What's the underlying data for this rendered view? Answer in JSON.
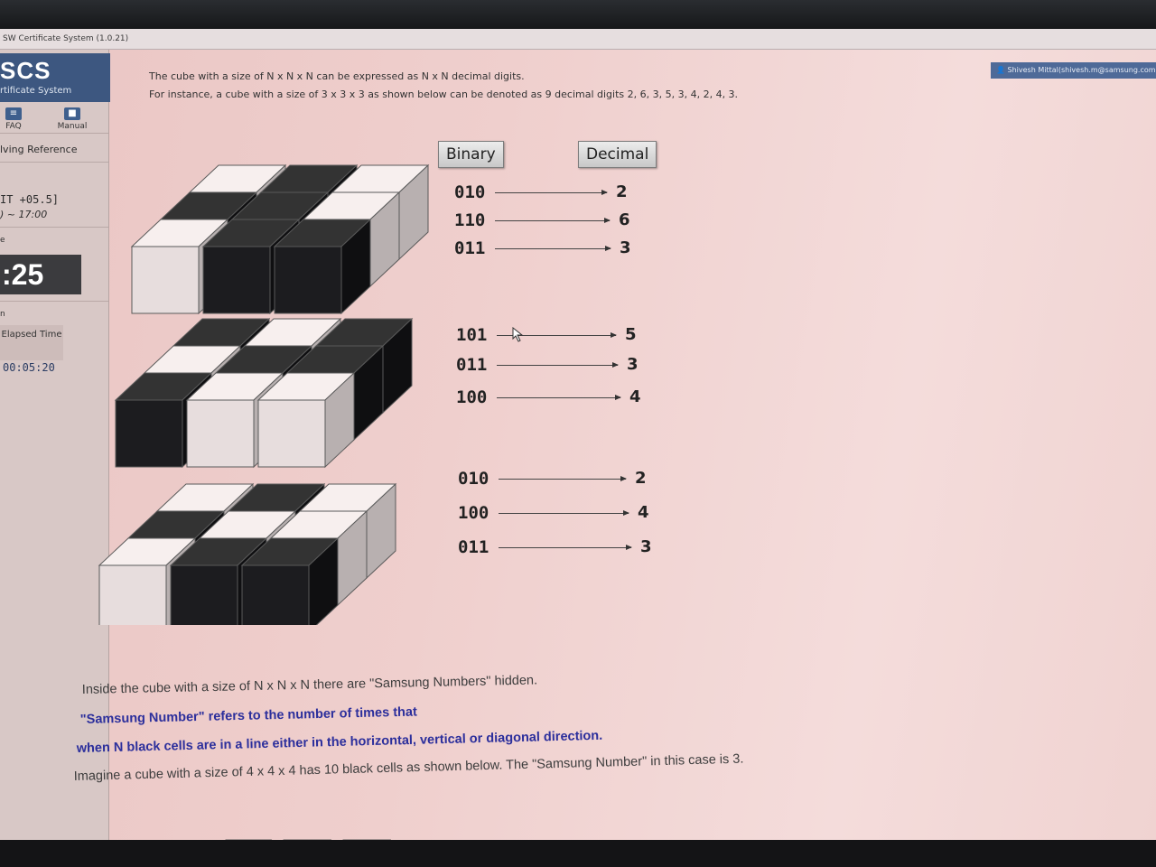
{
  "window": {
    "title": "SW Certificate System (1.0.21)"
  },
  "sidebar": {
    "logo": "SCS",
    "logo_sub": "rtificate System",
    "faq_label": "FAQ",
    "manual_label": "Manual",
    "reference_label": "lving Reference",
    "timezone": "IT +05.5]",
    "hours": ") ~ 17:00",
    "small_mark": "e",
    "timer": ":25",
    "small_mark2": "n",
    "elapsed_label": "Elapsed Time",
    "elapsed_value": "00:05:20"
  },
  "header": {
    "user": "Shivesh Mittal(shivesh.m@samsung.com"
  },
  "intro": {
    "line1": "The cube with a size of N x N x N can be expressed as N x N decimal digits.",
    "line2": "For instance, a cube with a size of 3 x 3 x 3 as shown below can be denoted as 9 decimal digits 2, 6, 3, 5, 3, 4, 2, 4, 3."
  },
  "table": {
    "binary_header": "Binary",
    "decimal_header": "Decimal",
    "rows": [
      {
        "bin": "010",
        "dec": "2"
      },
      {
        "bin": "110",
        "dec": "6"
      },
      {
        "bin": "011",
        "dec": "3"
      },
      {
        "bin": "101",
        "dec": "5"
      },
      {
        "bin": "011",
        "dec": "3"
      },
      {
        "bin": "100",
        "dec": "4"
      },
      {
        "bin": "010",
        "dec": "2"
      },
      {
        "bin": "100",
        "dec": "4"
      },
      {
        "bin": "011",
        "dec": "3"
      }
    ]
  },
  "cube_layers": [
    [
      [
        0,
        1,
        0
      ],
      [
        1,
        1,
        0
      ],
      [
        0,
        1,
        1
      ]
    ],
    [
      [
        1,
        0,
        1
      ],
      [
        0,
        1,
        1
      ],
      [
        1,
        0,
        0
      ]
    ],
    [
      [
        0,
        1,
        0
      ],
      [
        1,
        0,
        0
      ],
      [
        0,
        1,
        1
      ]
    ]
  ],
  "colors": {
    "black_cube": "#1c1c1f",
    "white_cube": "#ece2e1",
    "accent": "#3d5780",
    "link_blue": "#2c2f9c"
  },
  "paragraph": {
    "line1": "Inside the cube with a size of N x N x N there are \"Samsung Numbers\" hidden.",
    "line2": "\"Samsung Number\" refers to the number of times that",
    "line3": "when N black cells are in a line either in the horizontal, vertical or diagonal direction.",
    "line4": "Imagine a cube with a size of 4 x 4 x 4 has 10 black cells as shown below. The \"Samsung Number\" in this case is 3."
  }
}
